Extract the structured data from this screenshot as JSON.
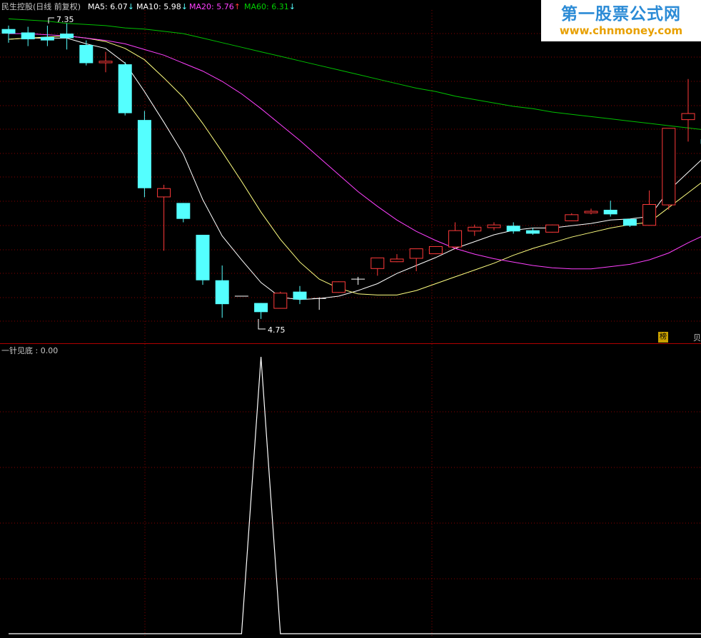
{
  "header": {
    "stock_label": "民生控股(日线 前复权)",
    "ma5_label": "MA5: 6.07",
    "ma10_label": "MA10: 5.98",
    "ma20_label": "MA20: 5.76",
    "ma60_label": "MA60: 6.31",
    "ma5_arrow": "↓",
    "ma10_arrow": "↓",
    "ma20_arrow": "↑",
    "ma60_arrow": "↓"
  },
  "indicator": {
    "title": "一针见底 : 0.00"
  },
  "watermark": {
    "title": "第一股票公式网",
    "url": "www.chnmoney.com"
  },
  "badges": {
    "bang": "榜",
    "edge": "贝"
  },
  "colors": {
    "up": "#ff3a3a",
    "down": "#54ffff",
    "ma5": "#ffffff",
    "ma10": "#ffff80",
    "ma20": "#ff40ff",
    "ma60": "#00c000",
    "grid": "#8b0000",
    "header_text": "#c8c8c8"
  },
  "chart_data": [
    {
      "type": "candlestick",
      "annotations": [
        {
          "text": "7.35",
          "index": 3,
          "value": 7.35
        },
        {
          "text": "4.75",
          "index": 13,
          "value": 4.75
        }
      ],
      "candles": [
        {
          "o": 7.3,
          "h": 7.33,
          "l": 7.18,
          "c": 7.26
        },
        {
          "o": 7.27,
          "h": 7.32,
          "l": 7.15,
          "c": 7.21
        },
        {
          "o": 7.23,
          "h": 7.33,
          "l": 7.15,
          "c": 7.2
        },
        {
          "o": 7.26,
          "h": 7.35,
          "l": 7.12,
          "c": 7.22
        },
        {
          "o": 7.16,
          "h": 7.2,
          "l": 6.98,
          "c": 7.0
        },
        {
          "o": 7.0,
          "h": 7.1,
          "l": 6.92,
          "c": 7.02
        },
        {
          "o": 6.99,
          "h": 7.01,
          "l": 6.54,
          "c": 6.56
        },
        {
          "o": 6.5,
          "h": 6.58,
          "l": 5.82,
          "c": 5.9
        },
        {
          "o": 5.82,
          "h": 5.93,
          "l": 5.35,
          "c": 5.9
        },
        {
          "o": 5.77,
          "h": 5.77,
          "l": 5.6,
          "c": 5.63
        },
        {
          "o": 5.49,
          "h": 5.49,
          "l": 5.05,
          "c": 5.09
        },
        {
          "o": 5.09,
          "h": 5.22,
          "l": 4.76,
          "c": 4.88
        },
        {
          "o": 4.95,
          "h": 4.95,
          "l": 4.95,
          "c": 4.95
        },
        {
          "o": 4.89,
          "h": 4.89,
          "l": 4.75,
          "c": 4.81
        },
        {
          "o": 4.84,
          "h": 4.99,
          "l": 4.84,
          "c": 4.98
        },
        {
          "o": 4.99,
          "h": 5.04,
          "l": 4.88,
          "c": 4.92
        },
        {
          "o": 4.93,
          "h": 4.94,
          "l": 4.83,
          "c": 4.93
        },
        {
          "o": 4.98,
          "h": 5.08,
          "l": 4.98,
          "c": 5.08
        },
        {
          "o": 5.1,
          "h": 5.12,
          "l": 5.05,
          "c": 5.1
        },
        {
          "o": 5.19,
          "h": 5.28,
          "l": 5.13,
          "c": 5.29
        },
        {
          "o": 5.25,
          "h": 5.32,
          "l": 5.25,
          "c": 5.28
        },
        {
          "o": 5.28,
          "h": 5.35,
          "l": 5.17,
          "c": 5.37
        },
        {
          "o": 5.32,
          "h": 5.39,
          "l": 5.32,
          "c": 5.39
        },
        {
          "o": 5.38,
          "h": 5.6,
          "l": 5.37,
          "c": 5.53
        },
        {
          "o": 5.52,
          "h": 5.58,
          "l": 5.48,
          "c": 5.56
        },
        {
          "o": 5.55,
          "h": 5.6,
          "l": 5.53,
          "c": 5.58
        },
        {
          "o": 5.57,
          "h": 5.6,
          "l": 5.5,
          "c": 5.52
        },
        {
          "o": 5.53,
          "h": 5.55,
          "l": 5.49,
          "c": 5.5
        },
        {
          "o": 5.51,
          "h": 5.58,
          "l": 5.51,
          "c": 5.58
        },
        {
          "o": 5.61,
          "h": 5.68,
          "l": 5.61,
          "c": 5.67
        },
        {
          "o": 5.68,
          "h": 5.72,
          "l": 5.67,
          "c": 5.7
        },
        {
          "o": 5.71,
          "h": 5.79,
          "l": 5.65,
          "c": 5.67
        },
        {
          "o": 5.63,
          "h": 5.63,
          "l": 5.56,
          "c": 5.57
        },
        {
          "o": 5.57,
          "h": 5.88,
          "l": 5.57,
          "c": 5.76
        },
        {
          "o": 5.75,
          "h": 6.26,
          "l": 5.71,
          "c": 6.43
        },
        {
          "o": 6.5,
          "h": 6.86,
          "l": 6.31,
          "c": 6.56
        },
        {
          "o": 6.33,
          "h": 6.45,
          "l": 6.26,
          "c": 6.29
        }
      ],
      "ylim": [
        4.63,
        7.43
      ],
      "ma_lines": [
        {
          "name": "MA5",
          "values": [
            7.21,
            7.22,
            7.22,
            7.22,
            7.17,
            7.13,
            7.0,
            6.75,
            6.48,
            6.2,
            5.8,
            5.48,
            5.27,
            5.07,
            4.94,
            4.92,
            4.93,
            4.95,
            5.0,
            5.06,
            5.15,
            5.22,
            5.29,
            5.37,
            5.43,
            5.49,
            5.53,
            5.55,
            5.55,
            5.57,
            5.59,
            5.62,
            5.63,
            5.65,
            5.88,
            6.04,
            6.2
          ]
        },
        {
          "name": "MA10",
          "values": [
            7.21,
            7.22,
            7.23,
            7.24,
            7.22,
            7.19,
            7.13,
            7.03,
            6.87,
            6.7,
            6.47,
            6.22,
            5.96,
            5.69,
            5.45,
            5.25,
            5.1,
            5.02,
            4.97,
            4.96,
            4.96,
            5.0,
            5.06,
            5.12,
            5.18,
            5.24,
            5.31,
            5.37,
            5.42,
            5.47,
            5.51,
            5.55,
            5.58,
            5.6,
            5.73,
            5.86,
            5.99
          ]
        },
        {
          "name": "MA20",
          "values": [
            7.26,
            7.26,
            7.25,
            7.24,
            7.22,
            7.2,
            7.17,
            7.12,
            7.07,
            7.0,
            6.93,
            6.84,
            6.73,
            6.6,
            6.46,
            6.32,
            6.17,
            6.02,
            5.87,
            5.74,
            5.62,
            5.52,
            5.44,
            5.37,
            5.32,
            5.28,
            5.25,
            5.22,
            5.2,
            5.19,
            5.19,
            5.21,
            5.23,
            5.27,
            5.33,
            5.42,
            5.5
          ]
        },
        {
          "name": "MA60",
          "values": [
            7.39,
            7.38,
            7.37,
            7.35,
            7.34,
            7.33,
            7.31,
            7.3,
            7.28,
            7.26,
            7.22,
            7.18,
            7.14,
            7.1,
            7.06,
            7.02,
            6.98,
            6.94,
            6.9,
            6.86,
            6.82,
            6.78,
            6.75,
            6.71,
            6.68,
            6.65,
            6.62,
            6.6,
            6.57,
            6.55,
            6.53,
            6.51,
            6.49,
            6.47,
            6.45,
            6.43,
            6.41
          ]
        }
      ]
    },
    {
      "type": "line",
      "series": [
        {
          "values": [
            0,
            0,
            0,
            0,
            0,
            0,
            0,
            0,
            0,
            0,
            0,
            0,
            0,
            1,
            0,
            0,
            0,
            0,
            0,
            0,
            0,
            0,
            0,
            0,
            0,
            0,
            0,
            0,
            0,
            0,
            0,
            0,
            0,
            0,
            0,
            0,
            0
          ]
        }
      ],
      "ylim": [
        0,
        1
      ]
    }
  ]
}
